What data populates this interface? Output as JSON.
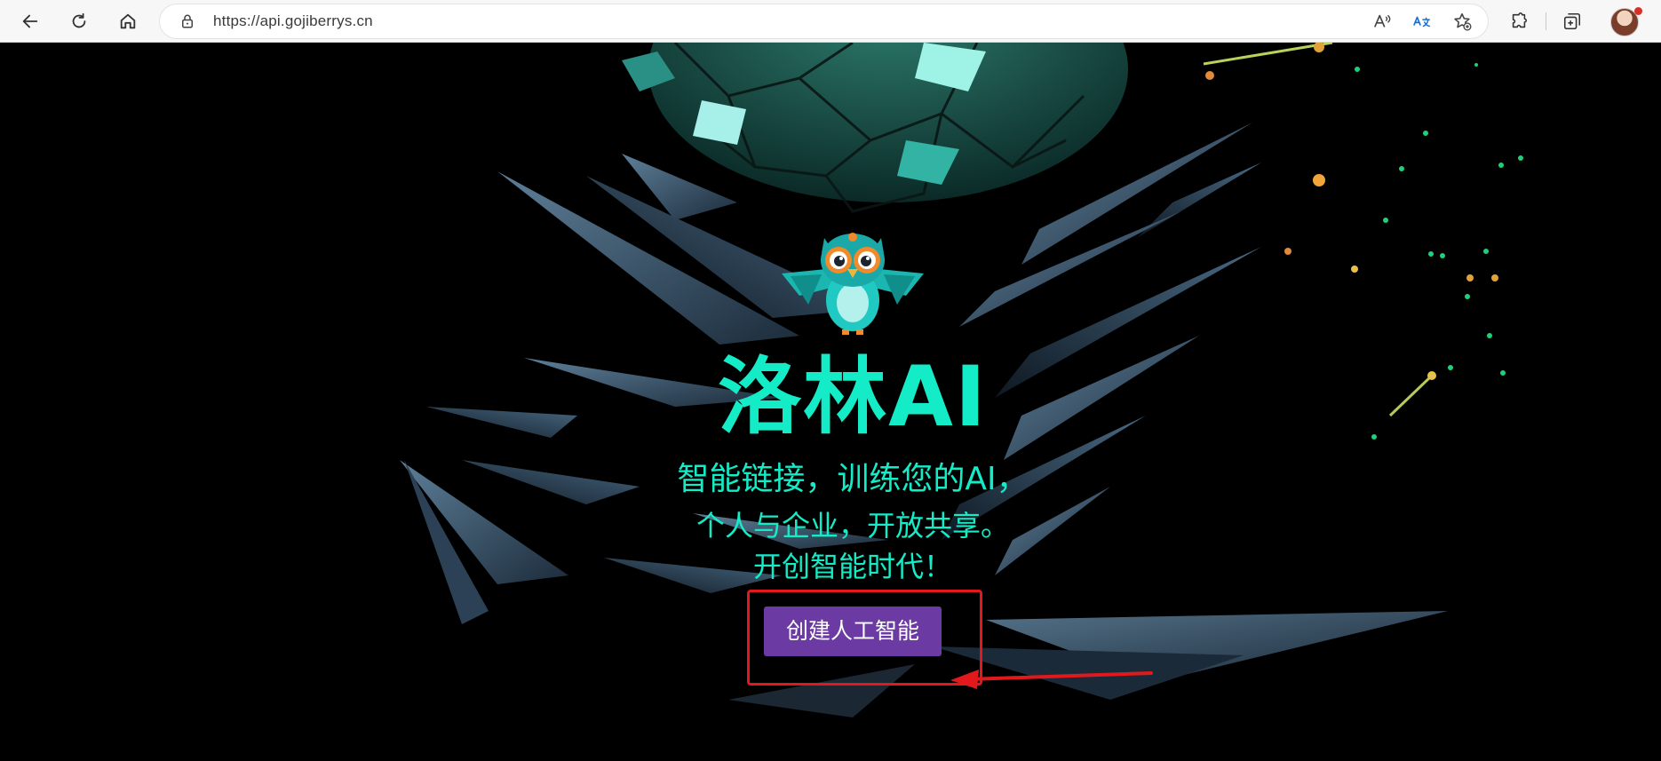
{
  "browser": {
    "url": "https://api.gojiberrys.cn"
  },
  "hero": {
    "title": "洛林AI",
    "tagline_1": "智能链接，训练您的AI，",
    "tagline_2": "个人与企业，开放共享。",
    "tagline_3": "开创智能时代！",
    "cta_label": "创建人工智能"
  },
  "colors": {
    "accent_text": "#14ebc7",
    "cta_background": "#6b3aa3",
    "annotation": "#e1191d",
    "background": "#000000"
  },
  "icons": [
    "back-icon",
    "refresh-icon",
    "home-icon",
    "lock-icon",
    "read-aloud-icon",
    "translate-icon",
    "add-favorite-icon",
    "extensions-icon",
    "collections-icon",
    "profile-avatar"
  ]
}
